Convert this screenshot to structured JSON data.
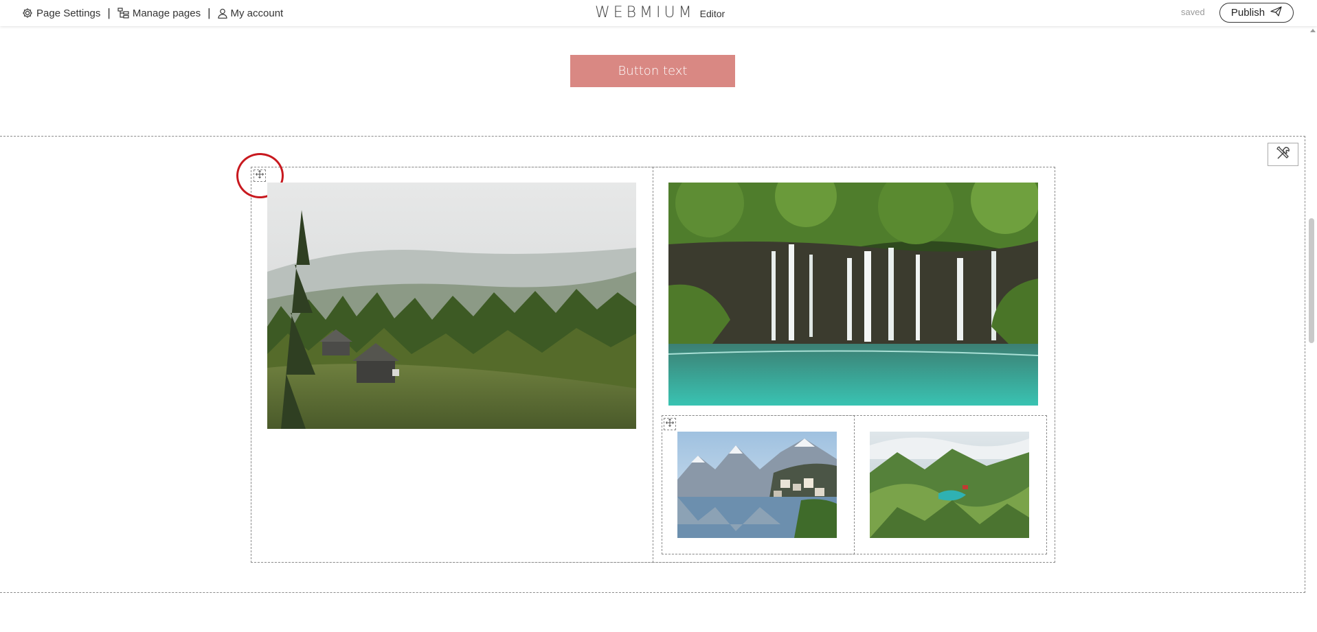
{
  "topbar": {
    "page_settings": "Page Settings",
    "manage_pages": "Manage pages",
    "my_account": "My account",
    "separator": "|",
    "brand": "WEBMIUM",
    "brand_sub": "Editor",
    "status": "saved",
    "publish": "Publish"
  },
  "section_button": {
    "label": "Button text",
    "color": "#d98883"
  },
  "gallery": {
    "images": [
      {
        "name": "forest-cabins-image",
        "subject": "misty forest with wooden cabins"
      },
      {
        "name": "waterfall-image",
        "subject": "waterfalls into turquoise lake"
      },
      {
        "name": "lake-village-image",
        "subject": "alpine lake village with mountains"
      },
      {
        "name": "mountain-valley-image",
        "subject": "green mountain valley with lake"
      }
    ]
  },
  "colors": {
    "selection_ring": "#c8191f",
    "dashed_border": "#8a8a8a"
  }
}
